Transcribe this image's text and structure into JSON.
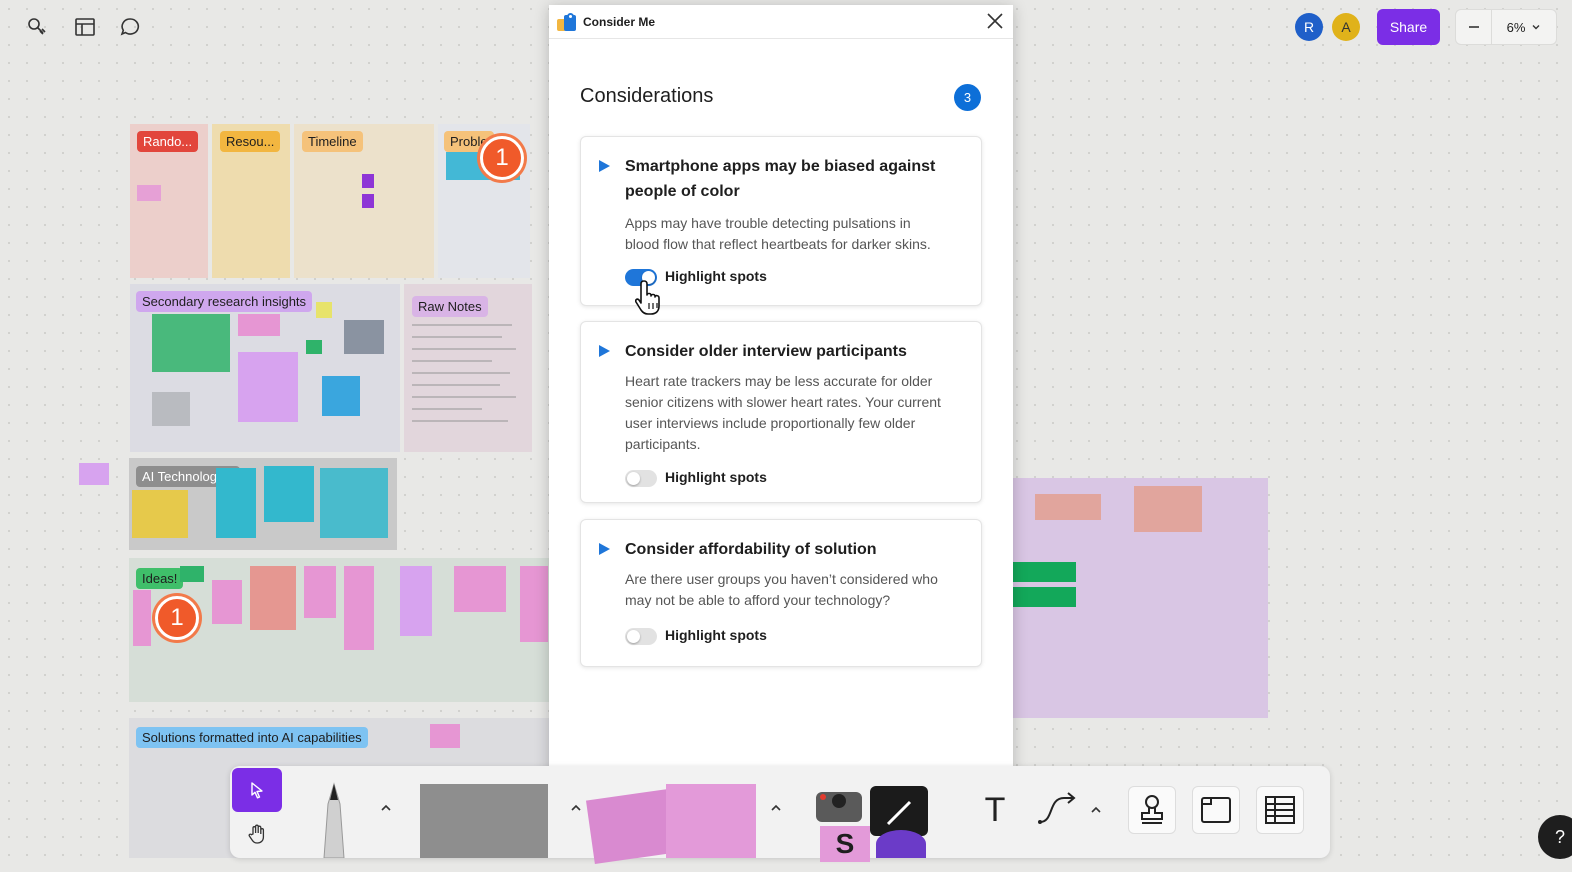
{
  "toolbar_top": {
    "icons": [
      "ai-actions-icon",
      "layout-icon",
      "comment-icon"
    ],
    "avatars": [
      {
        "initial": "R",
        "color": "#1f5fc9"
      },
      {
        "initial": "A",
        "color": "#e0b21a"
      }
    ],
    "share_label": "Share",
    "zoom": "6%"
  },
  "board": {
    "sections": {
      "random": "Rando...",
      "resources": "Resou...",
      "timeline": "Timeline",
      "problem": "Proble",
      "secondary": "Secondary research insights",
      "raw_notes": "Raw Notes",
      "ai_tech": "AI Technologies",
      "ideas": "Ideas!",
      "solutions": "Solutions formatted into AI capabilities"
    },
    "badges": [
      "1",
      "1"
    ]
  },
  "panel": {
    "app_name": "Consider Me",
    "heading": "Considerations",
    "count": "3",
    "cards": [
      {
        "title": "Smartphone apps may be biased against people of color",
        "description": "Apps may have trouble detecting pulsations in blood flow that reflect heartbeats for darker skins.",
        "toggle_label": "Highlight spots",
        "toggle_on": true
      },
      {
        "title": "Consider older interview participants",
        "description": "Heart rate trackers may be less accurate for older senior citizens with slower heart rates. Your current user interviews include proportionally few older participants.",
        "toggle_label": "Highlight spots",
        "toggle_on": false
      },
      {
        "title": "Consider affordability of solution",
        "description": "Are there user groups you haven’t considered who may not be able to afford your technology?",
        "toggle_label": "Highlight spots",
        "toggle_on": false
      }
    ]
  },
  "bottom_toolbar": {
    "tools": [
      "select-tool",
      "hand-tool",
      "marker-tool",
      "shape-tool",
      "sticky-note-tool",
      "widgets-tool",
      "text-tool",
      "connector-tool",
      "stamp-tool",
      "section-tool",
      "table-tool"
    ],
    "text_tool_glyph": "T",
    "widget_letter": "S"
  },
  "help_label": "?",
  "colors": {
    "accent": "#7b2ee6",
    "toggle_on": "#1f76d9",
    "badge": "#f05a2a",
    "count_badge": "#0d6fd8"
  }
}
